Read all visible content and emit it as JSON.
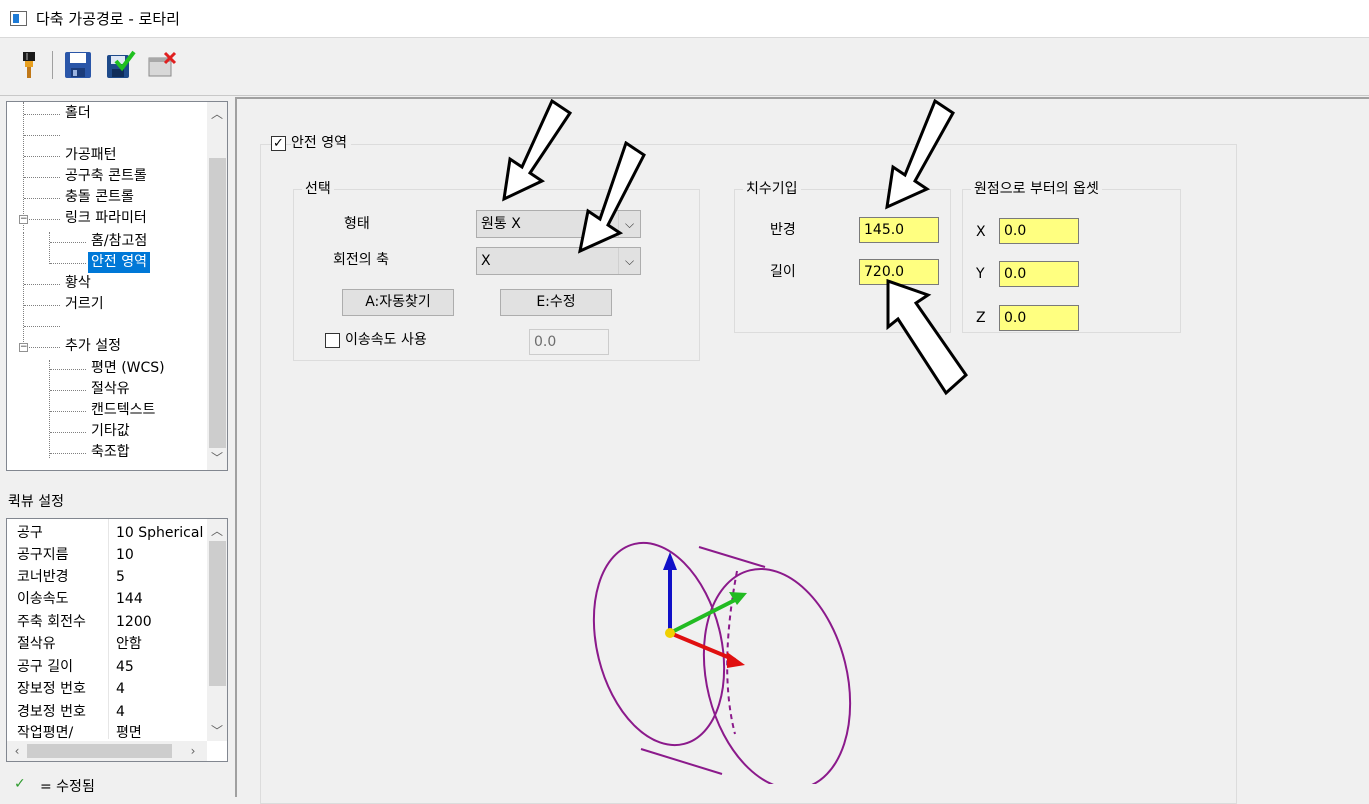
{
  "window": {
    "title": "다축 가공경로 - 로타리"
  },
  "toolbar": {
    "icons": [
      "tool-icon",
      "save-icon",
      "save-and-apply-icon",
      "cancel-icon"
    ]
  },
  "tree": {
    "items": [
      {
        "label": "홀더"
      },
      {
        "label": ""
      },
      {
        "label": "가공패턴"
      },
      {
        "label": "공구축 콘트롤"
      },
      {
        "label": "충돌 콘트롤"
      },
      {
        "label": "링크 파라미터"
      },
      {
        "label": "홈/참고점"
      },
      {
        "label": "안전 영역"
      },
      {
        "label": "황삭"
      },
      {
        "label": "거르기"
      },
      {
        "label": ""
      },
      {
        "label": "추가 설정"
      },
      {
        "label": "평면 (WCS)"
      },
      {
        "label": "절삭유"
      },
      {
        "label": "캔드텍스트"
      },
      {
        "label": "기타값"
      },
      {
        "label": "축조합"
      }
    ]
  },
  "quickview": {
    "title": "퀵뷰 설정",
    "rows": [
      {
        "key": "공구",
        "value": "10 Spherical /"
      },
      {
        "key": "공구지름",
        "value": "10"
      },
      {
        "key": "코너반경",
        "value": "5"
      },
      {
        "key": "이송속도",
        "value": "144"
      },
      {
        "key": "주축 회전수",
        "value": "1200"
      },
      {
        "key": "절삭유",
        "value": "안함"
      },
      {
        "key": "공구 길이",
        "value": "45"
      },
      {
        "key": "장보정 번호",
        "value": "4"
      },
      {
        "key": "경보정 번호",
        "value": "4"
      },
      {
        "key": "작업평면/",
        "value": "평면"
      }
    ]
  },
  "legend": {
    "check": "✓",
    "text": "= 수정됨"
  },
  "safety": {
    "enable_label": "안전 영역",
    "enabled": true,
    "selection": {
      "title": "선택",
      "shape_label": "형태",
      "shape_value": "원통 X",
      "axis_label": "회전의 축",
      "axis_value": "X",
      "auto_find_button": "A:자동찾기",
      "edit_button": "E:수정",
      "feed_label": "이송속도 사용",
      "feed_value": "0.0"
    },
    "dimensions": {
      "title": "치수기입",
      "radius_label": "반경",
      "radius_value": "145.0",
      "length_label": "길이",
      "length_value": "720.0"
    },
    "offset": {
      "title": "원점으로 부터의 옵셋",
      "x_label": "X",
      "x_value": "0.0",
      "y_label": "Y",
      "y_value": "0.0",
      "z_label": "Z",
      "z_value": "0.0"
    }
  },
  "colors": {
    "cylinder": "#8b1a8b",
    "axis_x": "#e01010",
    "axis_y": "#22bb22",
    "axis_z": "#1010c8",
    "origin": "#f0d000",
    "highlight_input": "#ffff80",
    "selection": "#0078d7"
  }
}
